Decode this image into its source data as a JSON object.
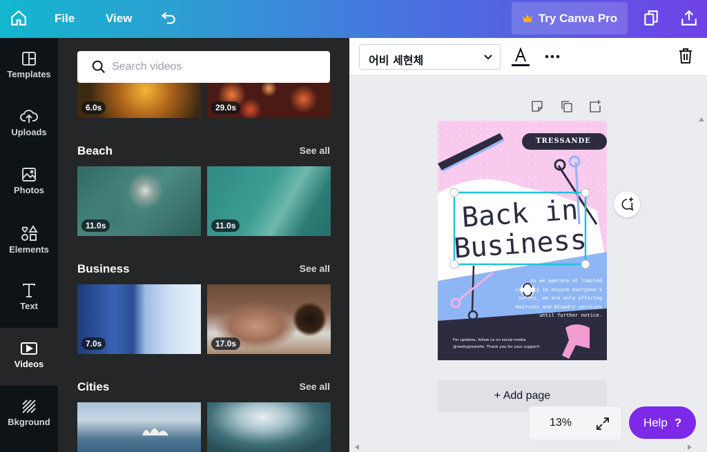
{
  "topbar": {
    "file_label": "File",
    "view_label": "View",
    "pro_label": "Try Canva Pro"
  },
  "sidebar": {
    "items": [
      {
        "label": "Templates",
        "icon": "templates-icon"
      },
      {
        "label": "Uploads",
        "icon": "upload-cloud-icon"
      },
      {
        "label": "Photos",
        "icon": "photo-icon"
      },
      {
        "label": "Elements",
        "icon": "shapes-icon"
      },
      {
        "label": "Text",
        "icon": "text-icon"
      },
      {
        "label": "Videos",
        "icon": "video-icon",
        "active": true
      },
      {
        "label": "Bkground",
        "icon": "background-icon"
      }
    ]
  },
  "panel": {
    "search_placeholder": "Search videos",
    "see_all_label": "See all",
    "top_row": [
      {
        "duration": "6.0s"
      },
      {
        "duration": "29.0s"
      }
    ],
    "sections": [
      {
        "title": "Beach",
        "videos": [
          {
            "duration": "11.0s"
          },
          {
            "duration": "11.0s"
          }
        ]
      },
      {
        "title": "Business",
        "videos": [
          {
            "duration": "7.0s"
          },
          {
            "duration": "17.0s"
          }
        ]
      },
      {
        "title": "Cities",
        "videos": [
          {
            "duration": ""
          },
          {
            "duration": ""
          }
        ]
      }
    ]
  },
  "toolbar": {
    "font_name": "어비 세현체"
  },
  "design": {
    "brand": "TRESSANDE",
    "headline_line1": "Back in",
    "headline_line2": "Business",
    "body": [
      "As we operate at limited",
      "capacity to ensure everyone's",
      "safety, we are only offering",
      "Haircuts and Blowdry services",
      "until further notice."
    ],
    "footer1": "For updates, follow us on social media",
    "footer2": "@reallygreatsite. Thank you for your support!"
  },
  "editor": {
    "add_page_label": "+ Add page",
    "zoom_label": "13%",
    "help_label": "Help",
    "help_symbol": "?"
  },
  "colors": {
    "accent_purple": "#7d2ae8",
    "canvas_pink": "#f9c9ee",
    "canvas_blue": "#8eb6f5",
    "canvas_navy": "#2d2b40",
    "selection_cyan": "#22c3d6"
  }
}
